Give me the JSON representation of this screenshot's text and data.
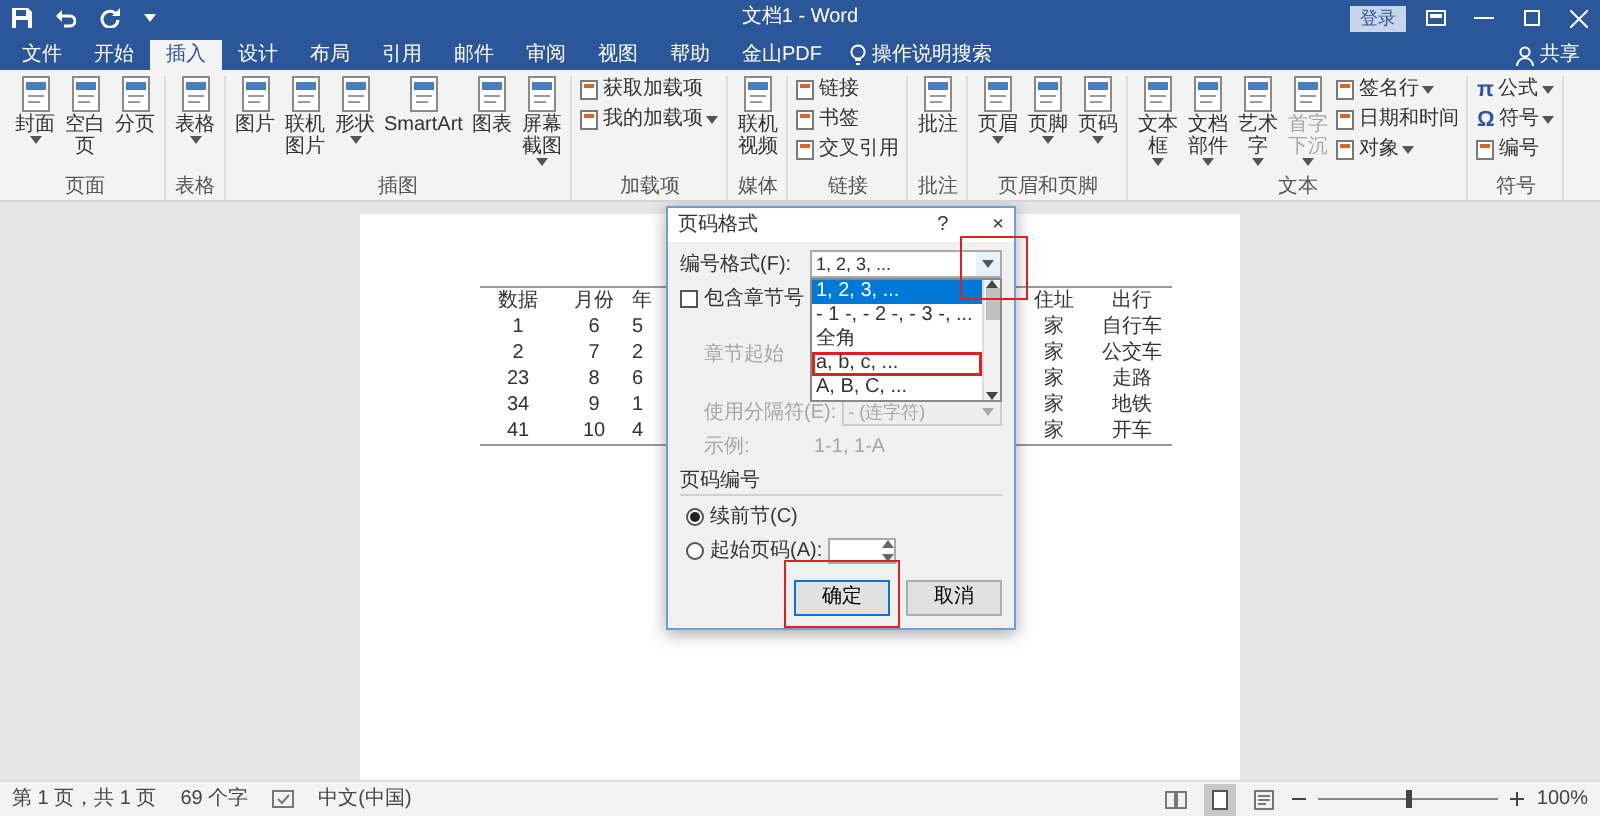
{
  "window": {
    "title": "文档1 - Word",
    "sign_in": "登录"
  },
  "tabs": [
    {
      "label": "文件",
      "selected": false
    },
    {
      "label": "开始",
      "selected": false
    },
    {
      "label": "插入",
      "selected": true
    },
    {
      "label": "设计",
      "selected": false
    },
    {
      "label": "布局",
      "selected": false
    },
    {
      "label": "引用",
      "selected": false
    },
    {
      "label": "邮件",
      "selected": false
    },
    {
      "label": "审阅",
      "selected": false
    },
    {
      "label": "视图",
      "selected": false
    },
    {
      "label": "帮助",
      "selected": false
    },
    {
      "label": "金山PDF",
      "selected": false
    }
  ],
  "search_hint": "操作说明搜索",
  "share": "共享",
  "ribbon": [
    {
      "label": "页面",
      "items": [
        {
          "kind": "large",
          "label": "封面",
          "dropdown": true
        },
        {
          "kind": "large",
          "label": "空白页"
        },
        {
          "kind": "large",
          "label": "分页"
        }
      ]
    },
    {
      "label": "表格",
      "items": [
        {
          "kind": "large",
          "label": "表格",
          "dropdown": true
        }
      ]
    },
    {
      "label": "插图",
      "items": [
        {
          "kind": "large",
          "label": "图片"
        },
        {
          "kind": "large",
          "label": "联机图片"
        },
        {
          "kind": "large",
          "label": "形状",
          "dropdown": true
        },
        {
          "kind": "large",
          "label": "SmartArt"
        },
        {
          "kind": "large",
          "label": "图表"
        },
        {
          "kind": "large",
          "label": "屏幕截图",
          "dropdown": true
        }
      ]
    },
    {
      "label": "加载项",
      "items": [
        {
          "kind": "small",
          "label": "获取加载项"
        },
        {
          "kind": "small",
          "label": "我的加载项",
          "dropdown": true
        }
      ]
    },
    {
      "label": "媒体",
      "items": [
        {
          "kind": "large",
          "label": "联机视频"
        }
      ]
    },
    {
      "label": "链接",
      "items": [
        {
          "kind": "small",
          "label": "链接"
        },
        {
          "kind": "small",
          "label": "书签"
        },
        {
          "kind": "small",
          "label": "交叉引用"
        }
      ]
    },
    {
      "label": "批注",
      "items": [
        {
          "kind": "large",
          "label": "批注"
        }
      ]
    },
    {
      "label": "页眉和页脚",
      "items": [
        {
          "kind": "large",
          "label": "页眉",
          "dropdown": true
        },
        {
          "kind": "large",
          "label": "页脚",
          "dropdown": true
        },
        {
          "kind": "large",
          "label": "页码",
          "dropdown": true
        }
      ]
    },
    {
      "label": "文本",
      "items": [
        {
          "kind": "large",
          "label": "文本框",
          "dropdown": true
        },
        {
          "kind": "large",
          "label": "文档部件",
          "dropdown": true
        },
        {
          "kind": "large",
          "label": "艺术字",
          "dropdown": true
        },
        {
          "kind": "large",
          "label": "首字下沉",
          "dropdown": true,
          "disabled": true
        },
        {
          "kind": "small",
          "label": "签名行",
          "dropdown": true
        },
        {
          "kind": "small",
          "label": "日期和时间"
        },
        {
          "kind": "small",
          "label": "对象",
          "dropdown": true
        }
      ]
    },
    {
      "label": "符号",
      "items": [
        {
          "kind": "small",
          "label": "公式",
          "glyph": "π",
          "dropdown": true
        },
        {
          "kind": "small",
          "label": "符号",
          "glyph": "Ω",
          "dropdown": true
        },
        {
          "kind": "small",
          "label": "编号"
        }
      ]
    }
  ],
  "table": {
    "columns": [
      "数据",
      "月份",
      "年",
      "住址",
      "出行"
    ],
    "rows": [
      [
        "1",
        "6",
        "5",
        "家",
        "自行车"
      ],
      [
        "2",
        "7",
        "2",
        "家",
        "公交车"
      ],
      [
        "23",
        "8",
        "6",
        "家",
        "走路"
      ],
      [
        "34",
        "9",
        "1",
        "家",
        "地铁"
      ],
      [
        "41",
        "10",
        "4",
        "家",
        "开车"
      ]
    ]
  },
  "dialog": {
    "title": "页码格式",
    "help": "?",
    "close": "×",
    "number_format": {
      "label": "编号格式(F):",
      "value": "1, 2, 3, ..."
    },
    "format_list": [
      {
        "label": "1, 2, 3, ...",
        "selected": true
      },
      {
        "label": "- 1 -, - 2 -, - 3 -, ...",
        "selected": false
      },
      {
        "label": "全角",
        "selected": false
      },
      {
        "label": "a, b, c, ...",
        "selected": false
      },
      {
        "label": "A, B, C, ...",
        "selected": false
      }
    ],
    "include_chapter": {
      "label": "包含章节号",
      "checked": false
    },
    "chapter_start": {
      "label": "章节起始",
      "disabled": true
    },
    "separator": {
      "label": "使用分隔符(E):",
      "value": "- (连字符)",
      "disabled": true
    },
    "example": {
      "label": "示例:",
      "value": "1-1, 1-A",
      "disabled": true
    },
    "numbering_section": "页码编号",
    "numbering_options": [
      {
        "label": "续前节(C)",
        "selected": true
      },
      {
        "label": "起始页码(A):",
        "selected": false
      }
    ],
    "buttons": [
      {
        "label": "确定",
        "default": true
      },
      {
        "label": "取消",
        "default": false
      }
    ]
  },
  "status_bar": {
    "page_info": "第 1 页，共 1 页",
    "word_count": "69 个字",
    "language": "中文(中国)",
    "views": [
      {
        "selected": false
      },
      {
        "selected": true
      },
      {
        "selected": false
      }
    ],
    "zoom": {
      "level": 0.5,
      "reading": "100%"
    }
  }
}
